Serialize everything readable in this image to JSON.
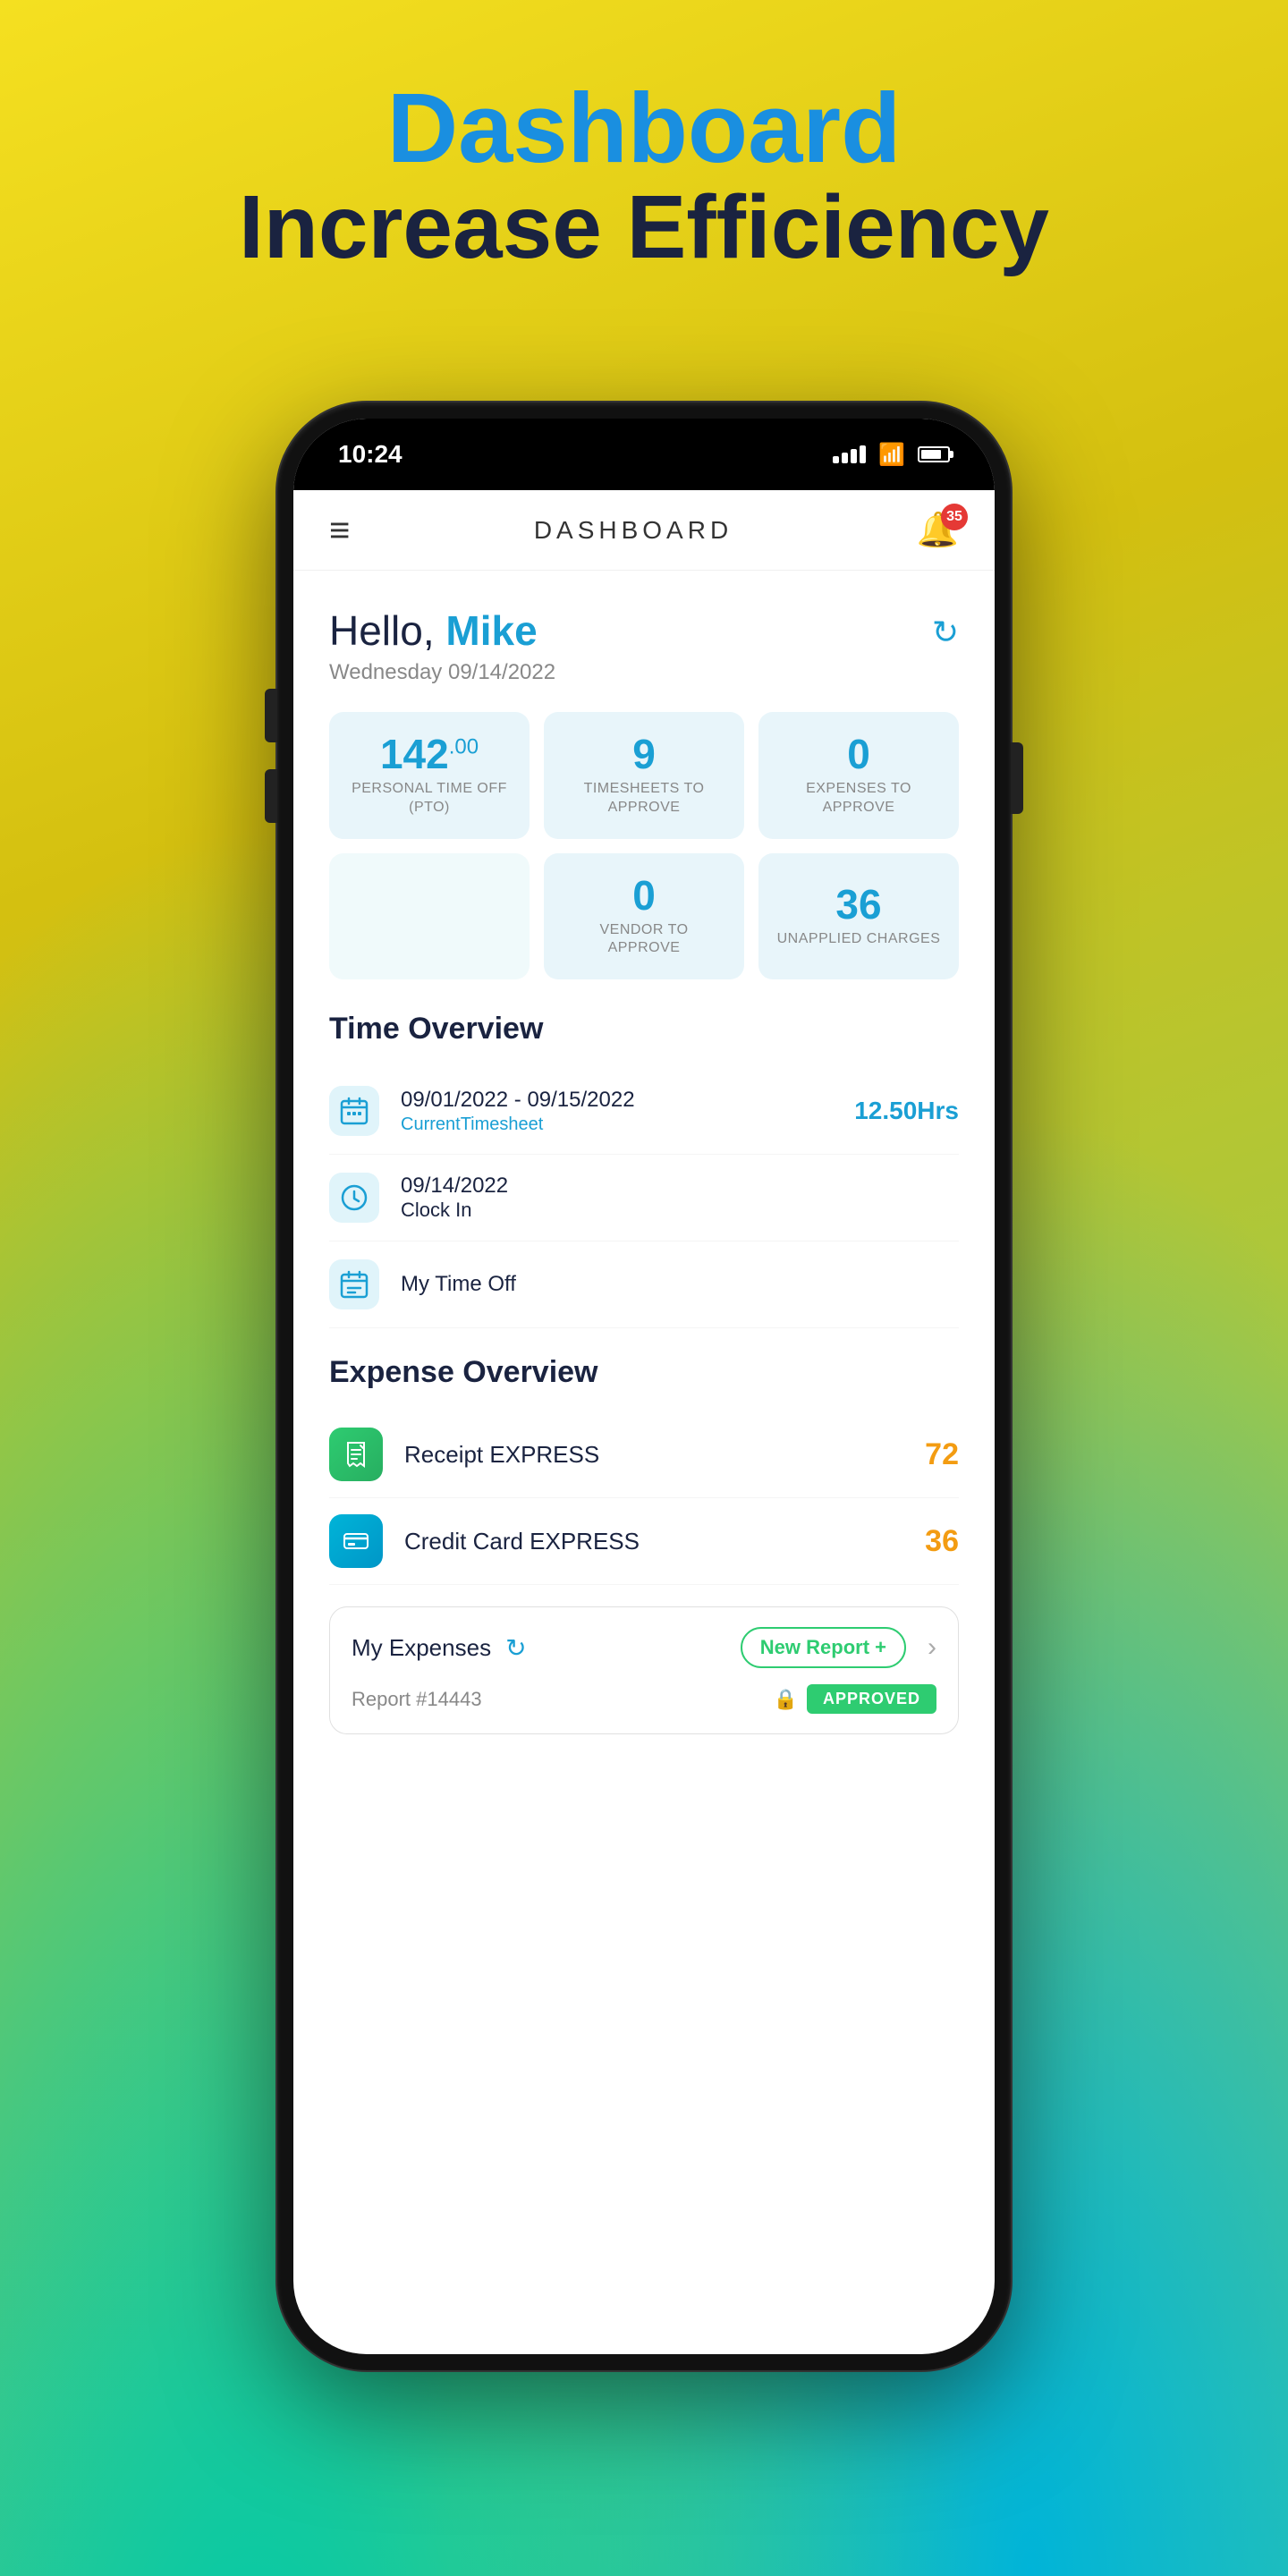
{
  "background": {
    "description": "Yellow to teal gradient background"
  },
  "top_text": {
    "title": "Dashboard",
    "subtitle": "Increase Efficiency"
  },
  "status_bar": {
    "time": "10:24",
    "battery": "80"
  },
  "header": {
    "title": "DASHBOARD",
    "notification_count": "35",
    "menu_icon": "≡",
    "bell_icon": "🔔"
  },
  "greeting": {
    "hello_text": "Hello, ",
    "name": "Mike",
    "date": "Wednesday 09/14/2022",
    "refresh_icon": "↻"
  },
  "stats": [
    {
      "value": "142",
      "value_decimal": ".00",
      "label": "Personal Time Off\n(PTO)"
    },
    {
      "value": "9",
      "label": "TIMESHEETS TO\nAPPROVE"
    },
    {
      "value": "0",
      "label": "EXPENSES TO\nAPPROVE"
    }
  ],
  "stats_row2": [
    {
      "value": "",
      "label": ""
    },
    {
      "value": "0",
      "label": "VENDOR TO\nAPPROVE"
    },
    {
      "value": "36",
      "label": "Unapplied Charges"
    }
  ],
  "time_overview": {
    "section_title": "Time Overview",
    "items": [
      {
        "date_range": "09/01/2022 - 09/15/2022",
        "sub_label": "CurrentTimesheet",
        "value": "12.50Hrs",
        "icon_type": "calendar"
      },
      {
        "date_range": "09/14/2022",
        "sub_label": "Clock In",
        "icon_type": "clock"
      },
      {
        "date_range": "My Time Off",
        "icon_type": "calendar2"
      }
    ]
  },
  "expense_overview": {
    "section_title": "Expense Overview",
    "items": [
      {
        "label": "Receipt  EXPRESS",
        "value": "72",
        "icon_type": "receipt"
      },
      {
        "label": "Credit Card  EXPRESS",
        "value": "36",
        "icon_type": "credit-card"
      }
    ]
  },
  "my_expenses": {
    "label": "My Expenses",
    "refresh_icon": "↻",
    "new_report_label": "New Report +",
    "arrow": "›",
    "report_id": "Report #14443",
    "status": "APPROVED",
    "lock_icon": "🔒"
  }
}
